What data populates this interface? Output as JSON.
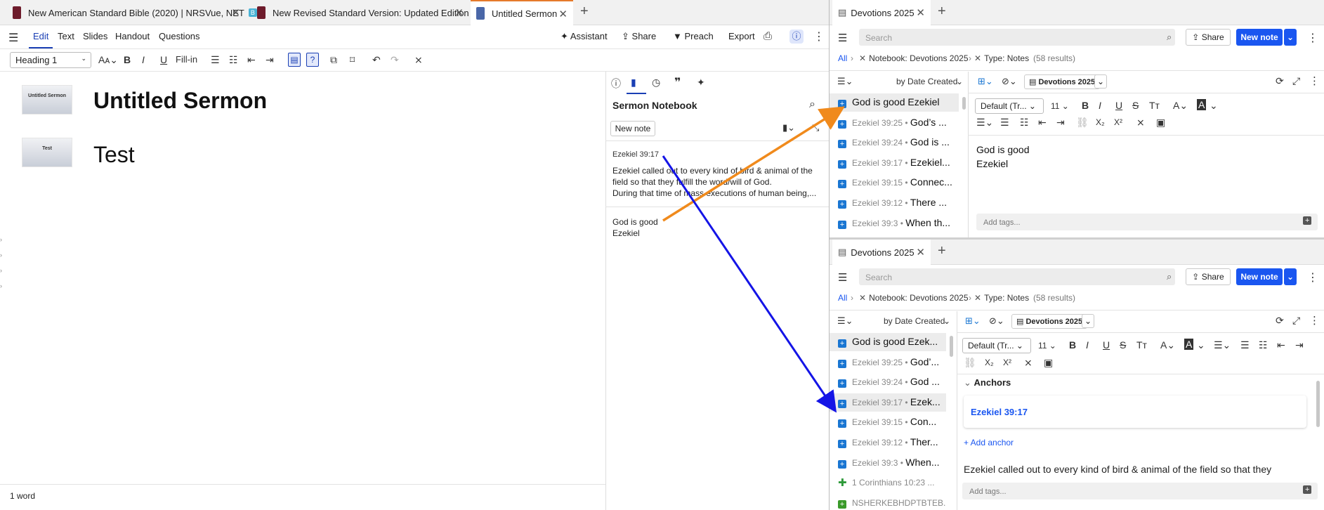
{
  "tabs": {
    "items": [
      {
        "label": "New American Standard Bible (2020) | NRSVue, NET",
        "badge": "B"
      },
      {
        "label": "New Revised Standard Version: Updated Edition"
      },
      {
        "label": "Untitled Sermon"
      }
    ]
  },
  "menu": {
    "edit": "Edit",
    "text": "Text",
    "slides": "Slides",
    "handout": "Handout",
    "questions": "Questions"
  },
  "actions": {
    "assistant": "Assistant",
    "share": "Share",
    "preach": "Preach",
    "export": "Export"
  },
  "toolbar": {
    "style": "Heading 1",
    "fillin": "Fill-in"
  },
  "doc": {
    "blocks": [
      {
        "thumb": "Untitled Sermon",
        "text": "Untitled Sermon"
      },
      {
        "thumb": "Test",
        "text": "Test"
      }
    ],
    "word_count": "1 word"
  },
  "notebook": {
    "title": "Sermon Notebook",
    "new_note": "New note",
    "note1": {
      "ref": "Ezekiel 39:17",
      "line1": "Ezekiel called out to every kind of bird & animal of the",
      "line2": "field so that they fulfill the word/will of God.",
      "line3": "During that time of mass executions of human being,..."
    },
    "note2": {
      "line1": "God is good",
      "line2": "Ezekiel"
    }
  },
  "panel_top": {
    "tab": "Devotions 2025",
    "search_placeholder": "Search",
    "share": "Share",
    "new_note": "New note",
    "crumb_all": "All",
    "filter_notebook": "Notebook: Devotions 2025",
    "filter_type": "Type: Notes",
    "results": "(58 results)",
    "sort": "by Date Created",
    "nb_chip": "Devotions 2025",
    "font": "Default (Tr...",
    "size": "11",
    "rows": [
      {
        "ref": "",
        "title": "God is good Ezekiel"
      },
      {
        "ref": "Ezekiel 39:25",
        "title": "God’s ..."
      },
      {
        "ref": "Ezekiel 39:24",
        "title": "God is ..."
      },
      {
        "ref": "Ezekiel 39:17",
        "title": "Ezekiel..."
      },
      {
        "ref": "Ezekiel 39:15",
        "title": "Connec..."
      },
      {
        "ref": "Ezekiel 39:12",
        "title": "There ..."
      },
      {
        "ref": "Ezekiel 39:3",
        "title": "When th..."
      }
    ],
    "editor_line1": "God is good",
    "editor_line2": "Ezekiel",
    "add_tags": "Add tags..."
  },
  "panel_bottom": {
    "tab": "Devotions 2025",
    "search_placeholder": "Search",
    "share": "Share",
    "new_note": "New note",
    "crumb_all": "All",
    "filter_notebook": "Notebook: Devotions 2025",
    "filter_type": "Type: Notes",
    "results": "(58 results)",
    "sort": "by Date Created",
    "nb_chip": "Devotions 2025",
    "font": "Default (Tr...",
    "size": "11",
    "rows": [
      {
        "ref": "",
        "title": "God is good Ezek..."
      },
      {
        "ref": "Ezekiel 39:25",
        "title": "God’..."
      },
      {
        "ref": "Ezekiel 39:24",
        "title": "God ..."
      },
      {
        "ref": "Ezekiel 39:17",
        "title": "Ezek..."
      },
      {
        "ref": "Ezekiel 39:15",
        "title": "Con..."
      },
      {
        "ref": "Ezekiel 39:12",
        "title": "Ther..."
      },
      {
        "ref": "Ezekiel 39:3",
        "title": "When..."
      },
      {
        "ref": "1 Corinthians 10:23 ...",
        "title": ""
      },
      {
        "ref": "NSHERKEBHDPTBTEB...",
        "title": ""
      }
    ],
    "anchors_label": "Anchors",
    "anchor_ref": "Ezekiel 39:17",
    "add_anchor": "+ Add anchor",
    "body": "Ezekiel called out to every kind of bird & animal of the field so that they",
    "add_tags": "Add tags..."
  },
  "colors": {
    "accent": "#1a56f0",
    "orange_arrow": "#f08a1c",
    "blue_arrow": "#1414e6"
  }
}
